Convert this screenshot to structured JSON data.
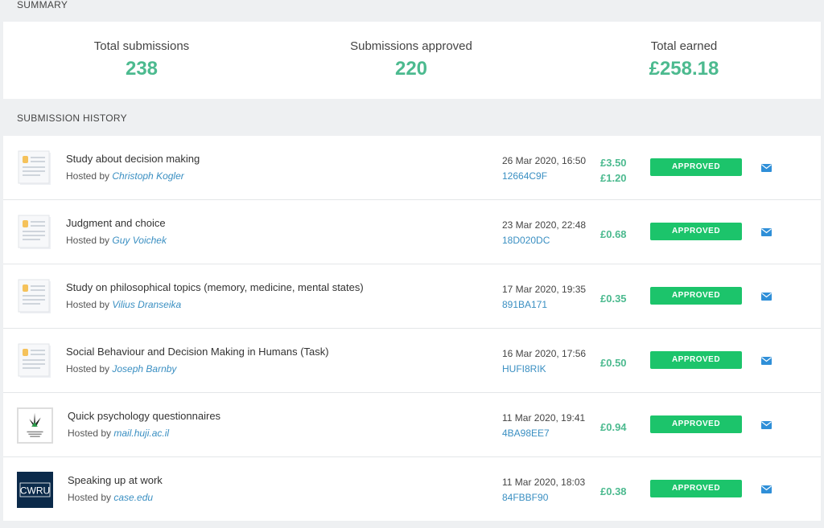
{
  "summary": {
    "label": "SUMMARY",
    "stats": [
      {
        "label": "Total submissions",
        "value": "238"
      },
      {
        "label": "Submissions approved",
        "value": "220"
      },
      {
        "label": "Total earned",
        "value": "£258.18"
      }
    ]
  },
  "history": {
    "label": "SUBMISSION HISTORY",
    "hosted_prefix": "Hosted by",
    "rows": [
      {
        "title": "Study about decision making",
        "host": "Christoph Kogler",
        "date": "26 Mar 2020, 16:50",
        "code": "12664C9F",
        "amount": "£3.50",
        "bonus": "£1.20",
        "status": "APPROVED",
        "thumb": "document-icon"
      },
      {
        "title": "Judgment and choice",
        "host": "Guy Voichek",
        "date": "23 Mar 2020, 22:48",
        "code": "18D020DC",
        "amount": "£0.68",
        "status": "APPROVED",
        "thumb": "document-icon"
      },
      {
        "title": "Study on philosophical topics (memory, medicine, mental states)",
        "host": "Vilius Dranseika",
        "date": "17 Mar 2020, 19:35",
        "code": "891BA171",
        "amount": "£0.35",
        "status": "APPROVED",
        "thumb": "document-icon"
      },
      {
        "title": "Social Behaviour and Decision Making in Humans (Task)",
        "host": "Joseph Barnby",
        "date": "16 Mar 2020, 17:56",
        "code": "HUFI8RIK",
        "amount": "£0.50",
        "status": "APPROVED",
        "thumb": "document-icon"
      },
      {
        "title": "Quick psychology questionnaires",
        "host": "mail.huji.ac.il",
        "date": "11 Mar 2020, 19:41",
        "code": "4BA98EE7",
        "amount": "£0.94",
        "status": "APPROVED",
        "thumb": "university-logo"
      },
      {
        "title": "Speaking up at work",
        "host": "case.edu",
        "date": "11 Mar 2020, 18:03",
        "code": "84FBBF90",
        "amount": "£0.38",
        "status": "APPROVED",
        "thumb": "cwru-logo",
        "logo_text": "CWRU"
      }
    ]
  },
  "colors": {
    "accent_green": "#4cba8f",
    "status_green": "#1cc46b",
    "link_blue": "#3a8fc2"
  }
}
